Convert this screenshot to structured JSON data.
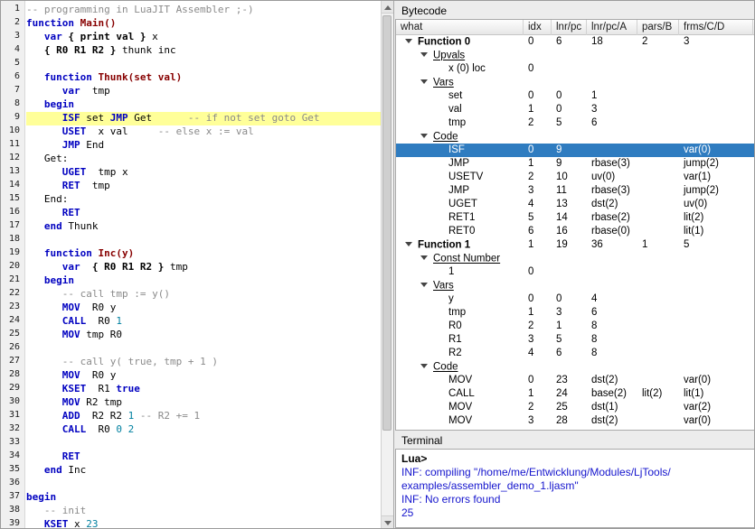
{
  "colors": {
    "selection": "#2f7cc0",
    "line_highlight": "#ffff99",
    "keyword": "#0000c0",
    "number": "#0080a0",
    "comment": "#8a8a8a",
    "function_name": "#870000",
    "terminal_info": "#1515cd"
  },
  "editor": {
    "highlight_line": 9,
    "lines": [
      {
        "n": 1,
        "segs": [
          [
            "c",
            "-- programming in LuaJIT Assembler ;-)"
          ]
        ]
      },
      {
        "n": 2,
        "segs": [
          [
            "k",
            "function"
          ],
          [
            "p",
            " "
          ],
          [
            "f",
            "Main()"
          ]
        ]
      },
      {
        "n": 3,
        "segs": [
          [
            "p",
            "   "
          ],
          [
            "k",
            "var"
          ],
          [
            "p",
            " "
          ],
          [
            "b",
            "{ print val }"
          ],
          [
            "p",
            " x"
          ]
        ]
      },
      {
        "n": 4,
        "segs": [
          [
            "p",
            "   "
          ],
          [
            "b",
            "{ R0 R1 R2 }"
          ],
          [
            "p",
            " thunk inc"
          ]
        ]
      },
      {
        "n": 5,
        "segs": []
      },
      {
        "n": 6,
        "segs": [
          [
            "p",
            "   "
          ],
          [
            "k",
            "function"
          ],
          [
            "p",
            " "
          ],
          [
            "f",
            "Thunk(set val)"
          ]
        ]
      },
      {
        "n": 7,
        "segs": [
          [
            "p",
            "      "
          ],
          [
            "k",
            "var"
          ],
          [
            "p",
            "  tmp"
          ]
        ]
      },
      {
        "n": 8,
        "segs": [
          [
            "p",
            "   "
          ],
          [
            "k",
            "begin"
          ]
        ]
      },
      {
        "n": 9,
        "segs": [
          [
            "p",
            "      "
          ],
          [
            "o",
            "ISF"
          ],
          [
            "p",
            " set "
          ],
          [
            "o",
            "JMP"
          ],
          [
            "p",
            " Get      "
          ],
          [
            "c",
            "-- if not set goto Get"
          ]
        ]
      },
      {
        "n": 10,
        "segs": [
          [
            "p",
            "      "
          ],
          [
            "o",
            "USET"
          ],
          [
            "p",
            "  x val     "
          ],
          [
            "c",
            "-- else x := val"
          ]
        ]
      },
      {
        "n": 11,
        "segs": [
          [
            "p",
            "      "
          ],
          [
            "o",
            "JMP"
          ],
          [
            "p",
            " End"
          ]
        ]
      },
      {
        "n": 12,
        "segs": [
          [
            "p",
            "   Get:"
          ]
        ]
      },
      {
        "n": 13,
        "segs": [
          [
            "p",
            "      "
          ],
          [
            "o",
            "UGET"
          ],
          [
            "p",
            "  tmp x"
          ]
        ]
      },
      {
        "n": 14,
        "segs": [
          [
            "p",
            "      "
          ],
          [
            "o",
            "RET"
          ],
          [
            "p",
            "  tmp"
          ]
        ]
      },
      {
        "n": 15,
        "segs": [
          [
            "p",
            "   End:"
          ]
        ]
      },
      {
        "n": 16,
        "segs": [
          [
            "p",
            "      "
          ],
          [
            "o",
            "RET"
          ]
        ]
      },
      {
        "n": 17,
        "segs": [
          [
            "p",
            "   "
          ],
          [
            "k",
            "end"
          ],
          [
            "p",
            " Thunk"
          ]
        ]
      },
      {
        "n": 18,
        "segs": []
      },
      {
        "n": 19,
        "segs": [
          [
            "p",
            "   "
          ],
          [
            "k",
            "function"
          ],
          [
            "p",
            " "
          ],
          [
            "f",
            "Inc(y)"
          ]
        ]
      },
      {
        "n": 20,
        "segs": [
          [
            "p",
            "      "
          ],
          [
            "k",
            "var"
          ],
          [
            "p",
            "  "
          ],
          [
            "b",
            "{ R0 R1 R2 }"
          ],
          [
            "p",
            " tmp"
          ]
        ]
      },
      {
        "n": 21,
        "segs": [
          [
            "p",
            "   "
          ],
          [
            "k",
            "begin"
          ]
        ]
      },
      {
        "n": 22,
        "segs": [
          [
            "p",
            "      "
          ],
          [
            "c",
            "-- call tmp := y()"
          ]
        ]
      },
      {
        "n": 23,
        "segs": [
          [
            "p",
            "      "
          ],
          [
            "o",
            "MOV"
          ],
          [
            "p",
            "  R0 y"
          ]
        ]
      },
      {
        "n": 24,
        "segs": [
          [
            "p",
            "      "
          ],
          [
            "o",
            "CALL"
          ],
          [
            "p",
            "  R0 "
          ],
          [
            "num",
            "1"
          ]
        ]
      },
      {
        "n": 25,
        "segs": [
          [
            "p",
            "      "
          ],
          [
            "o",
            "MOV"
          ],
          [
            "p",
            " tmp R0"
          ]
        ]
      },
      {
        "n": 26,
        "segs": []
      },
      {
        "n": 27,
        "segs": [
          [
            "p",
            "      "
          ],
          [
            "c",
            "-- call y( true, tmp + 1 )"
          ]
        ]
      },
      {
        "n": 28,
        "segs": [
          [
            "p",
            "      "
          ],
          [
            "o",
            "MOV"
          ],
          [
            "p",
            "  R0 y"
          ]
        ]
      },
      {
        "n": 29,
        "segs": [
          [
            "p",
            "      "
          ],
          [
            "o",
            "KSET"
          ],
          [
            "p",
            "  R1 "
          ],
          [
            "k",
            "true"
          ]
        ]
      },
      {
        "n": 30,
        "segs": [
          [
            "p",
            "      "
          ],
          [
            "o",
            "MOV"
          ],
          [
            "p",
            " R2 tmp"
          ]
        ]
      },
      {
        "n": 31,
        "segs": [
          [
            "p",
            "      "
          ],
          [
            "o",
            "ADD"
          ],
          [
            "p",
            "  R2 R2 "
          ],
          [
            "num",
            "1"
          ],
          [
            "p",
            " "
          ],
          [
            "c",
            "-- R2 += 1"
          ]
        ]
      },
      {
        "n": 32,
        "segs": [
          [
            "p",
            "      "
          ],
          [
            "o",
            "CALL"
          ],
          [
            "p",
            "  R0 "
          ],
          [
            "num",
            "0 2"
          ]
        ]
      },
      {
        "n": 33,
        "segs": []
      },
      {
        "n": 34,
        "segs": [
          [
            "p",
            "      "
          ],
          [
            "o",
            "RET"
          ]
        ]
      },
      {
        "n": 35,
        "segs": [
          [
            "p",
            "   "
          ],
          [
            "k",
            "end"
          ],
          [
            "p",
            " Inc"
          ]
        ]
      },
      {
        "n": 36,
        "segs": []
      },
      {
        "n": 37,
        "segs": [
          [
            "k",
            "begin"
          ]
        ]
      },
      {
        "n": 38,
        "segs": [
          [
            "p",
            "   "
          ],
          [
            "c",
            "-- init"
          ]
        ]
      },
      {
        "n": 39,
        "segs": [
          [
            "p",
            "   "
          ],
          [
            "o",
            "KSET"
          ],
          [
            "p",
            " x "
          ],
          [
            "num",
            "23"
          ]
        ]
      }
    ]
  },
  "bytecode": {
    "title": "Bytecode",
    "columns": [
      "what",
      "idx",
      "lnr/pc",
      "lnr/pc/A",
      "pars/B",
      "frms/C/D"
    ],
    "rows": [
      {
        "level": 0,
        "expanded": true,
        "style": "func",
        "what": "Function 0",
        "cells": [
          "0",
          "6",
          "18",
          "2",
          "3"
        ]
      },
      {
        "level": 1,
        "expanded": true,
        "style": "cat",
        "what": "Upvals",
        "cells": [
          "",
          "",
          "",
          "",
          ""
        ]
      },
      {
        "level": 2,
        "expanded": false,
        "style": "leaf",
        "what": "x (0) loc",
        "cells": [
          "0",
          "",
          "",
          "",
          ""
        ]
      },
      {
        "level": 1,
        "expanded": true,
        "style": "cat",
        "what": "Vars",
        "cells": [
          "",
          "",
          "",
          "",
          ""
        ]
      },
      {
        "level": 2,
        "expanded": false,
        "style": "leaf",
        "what": "set",
        "cells": [
          "0",
          "0",
          "1",
          "",
          ""
        ]
      },
      {
        "level": 2,
        "expanded": false,
        "style": "leaf",
        "what": "val",
        "cells": [
          "1",
          "0",
          "3",
          "",
          ""
        ]
      },
      {
        "level": 2,
        "expanded": false,
        "style": "leaf",
        "what": "tmp",
        "cells": [
          "2",
          "5",
          "6",
          "",
          ""
        ]
      },
      {
        "level": 1,
        "expanded": true,
        "style": "cat",
        "what": "Code",
        "cells": [
          "",
          "",
          "",
          "",
          ""
        ]
      },
      {
        "level": 2,
        "expanded": false,
        "style": "leaf",
        "what": "ISF",
        "cells": [
          "0",
          "9",
          "",
          "",
          "var(0)"
        ],
        "selected": true
      },
      {
        "level": 2,
        "expanded": false,
        "style": "leaf",
        "what": "JMP",
        "cells": [
          "1",
          "9",
          "rbase(3)",
          "",
          "jump(2)"
        ]
      },
      {
        "level": 2,
        "expanded": false,
        "style": "leaf",
        "what": "USETV",
        "cells": [
          "2",
          "10",
          "uv(0)",
          "",
          "var(1)"
        ]
      },
      {
        "level": 2,
        "expanded": false,
        "style": "leaf",
        "what": "JMP",
        "cells": [
          "3",
          "11",
          "rbase(3)",
          "",
          "jump(2)"
        ]
      },
      {
        "level": 2,
        "expanded": false,
        "style": "leaf",
        "what": "UGET",
        "cells": [
          "4",
          "13",
          "dst(2)",
          "",
          "uv(0)"
        ]
      },
      {
        "level": 2,
        "expanded": false,
        "style": "leaf",
        "what": "RET1",
        "cells": [
          "5",
          "14",
          "rbase(2)",
          "",
          "lit(2)"
        ]
      },
      {
        "level": 2,
        "expanded": false,
        "style": "leaf",
        "what": "RET0",
        "cells": [
          "6",
          "16",
          "rbase(0)",
          "",
          "lit(1)"
        ]
      },
      {
        "level": 0,
        "expanded": true,
        "style": "func",
        "what": "Function 1",
        "cells": [
          "1",
          "19",
          "36",
          "1",
          "5"
        ]
      },
      {
        "level": 1,
        "expanded": true,
        "style": "cat",
        "what": "Const Number",
        "cells": [
          "",
          "",
          "",
          "",
          ""
        ]
      },
      {
        "level": 2,
        "expanded": false,
        "style": "leaf",
        "what": "1",
        "cells": [
          "0",
          "",
          "",
          "",
          ""
        ]
      },
      {
        "level": 1,
        "expanded": true,
        "style": "cat",
        "what": "Vars",
        "cells": [
          "",
          "",
          "",
          "",
          ""
        ]
      },
      {
        "level": 2,
        "expanded": false,
        "style": "leaf",
        "what": "y",
        "cells": [
          "0",
          "0",
          "4",
          "",
          ""
        ]
      },
      {
        "level": 2,
        "expanded": false,
        "style": "leaf",
        "what": "tmp",
        "cells": [
          "1",
          "3",
          "6",
          "",
          ""
        ]
      },
      {
        "level": 2,
        "expanded": false,
        "style": "leaf",
        "what": "R0",
        "cells": [
          "2",
          "1",
          "8",
          "",
          ""
        ]
      },
      {
        "level": 2,
        "expanded": false,
        "style": "leaf",
        "what": "R1",
        "cells": [
          "3",
          "5",
          "8",
          "",
          ""
        ]
      },
      {
        "level": 2,
        "expanded": false,
        "style": "leaf",
        "what": "R2",
        "cells": [
          "4",
          "6",
          "8",
          "",
          ""
        ]
      },
      {
        "level": 1,
        "expanded": true,
        "style": "cat",
        "what": "Code",
        "cells": [
          "",
          "",
          "",
          "",
          ""
        ]
      },
      {
        "level": 2,
        "expanded": false,
        "style": "leaf",
        "what": "MOV",
        "cells": [
          "0",
          "23",
          "dst(2)",
          "",
          "var(0)"
        ]
      },
      {
        "level": 2,
        "expanded": false,
        "style": "leaf",
        "what": "CALL",
        "cells": [
          "1",
          "24",
          "base(2)",
          "lit(2)",
          "lit(1)"
        ]
      },
      {
        "level": 2,
        "expanded": false,
        "style": "leaf",
        "what": "MOV",
        "cells": [
          "2",
          "25",
          "dst(1)",
          "",
          "var(2)"
        ]
      },
      {
        "level": 2,
        "expanded": false,
        "style": "leaf",
        "what": "MOV",
        "cells": [
          "3",
          "28",
          "dst(2)",
          "",
          "var(0)"
        ]
      }
    ]
  },
  "terminal": {
    "title": "Terminal",
    "lines": [
      {
        "style": "prompt",
        "text": "Lua>"
      },
      {
        "style": "info",
        "text": "INF: compiling \"/home/me/Entwicklung/Modules/LjTools/"
      },
      {
        "style": "info",
        "text": "examples/assembler_demo_1.ljasm\""
      },
      {
        "style": "info",
        "text": "INF: No errors found"
      },
      {
        "style": "info",
        "text": "25"
      }
    ]
  }
}
